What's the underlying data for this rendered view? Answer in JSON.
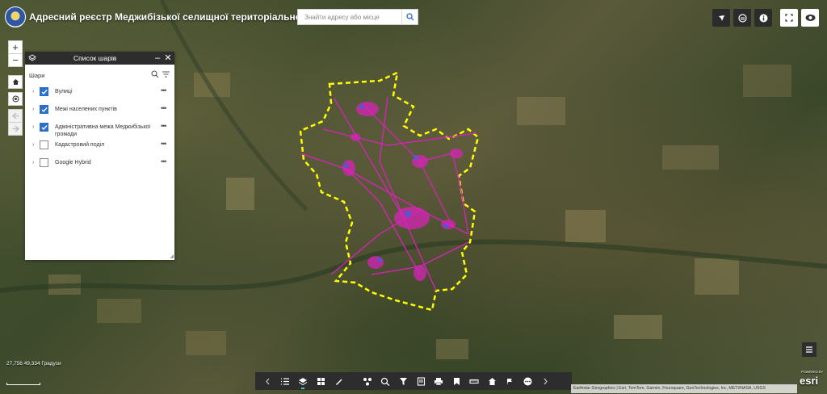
{
  "header": {
    "title": "Адресний реєстр Меджибізької селищної територіальної громади",
    "search_placeholder": "Знайти адресу або місце",
    "buttons": [
      "cursor-icon",
      "compare-icon",
      "info-icon",
      "fullscreen-icon",
      "eye-icon"
    ]
  },
  "map_nav": {
    "zoom_in": "+",
    "zoom_out": "−",
    "home": "home-icon",
    "locate": "locate-icon",
    "back": "arrow-left-icon",
    "forward": "arrow-right-icon"
  },
  "layer_panel": {
    "title": "Список шарів",
    "subheader": "Шари",
    "layers": [
      {
        "name": "Вулиці",
        "checked": true
      },
      {
        "name": "Межі населених пунктів",
        "checked": true
      },
      {
        "name": "Адміністративна межа Меджибізької громади",
        "checked": true
      },
      {
        "name": "Кадастровий поділ",
        "checked": false
      },
      {
        "name": "Google Hybrid",
        "checked": false
      }
    ],
    "more_label": "•••"
  },
  "coordinates": "27,756 49,334 Градуси",
  "toolbar": {
    "items": [
      "chevron-left-icon",
      "legend-icon",
      "layers-icon",
      "basemap-icon",
      "draw-icon",
      "analysis-icon",
      "query-icon",
      "filter-icon",
      "edit-icon",
      "print-icon",
      "bookmark-icon",
      "measure-icon",
      "home-icon",
      "directions-icon",
      "more-icon",
      "chevron-right-icon"
    ]
  },
  "attribution": "Earthstar Geographics | Esri, TomTom, Garmin, Foursquare, GeoTechnologies, Inc, METI/NASA, USGS",
  "esri_logo": "esri",
  "esri_powered": "POWERED BY",
  "colors": {
    "boundary": "#ffff00",
    "settlements": "#e020c0",
    "streets": "#4060e0",
    "checkbox": "#2a70c6",
    "header_button": "#2b2b2b"
  }
}
